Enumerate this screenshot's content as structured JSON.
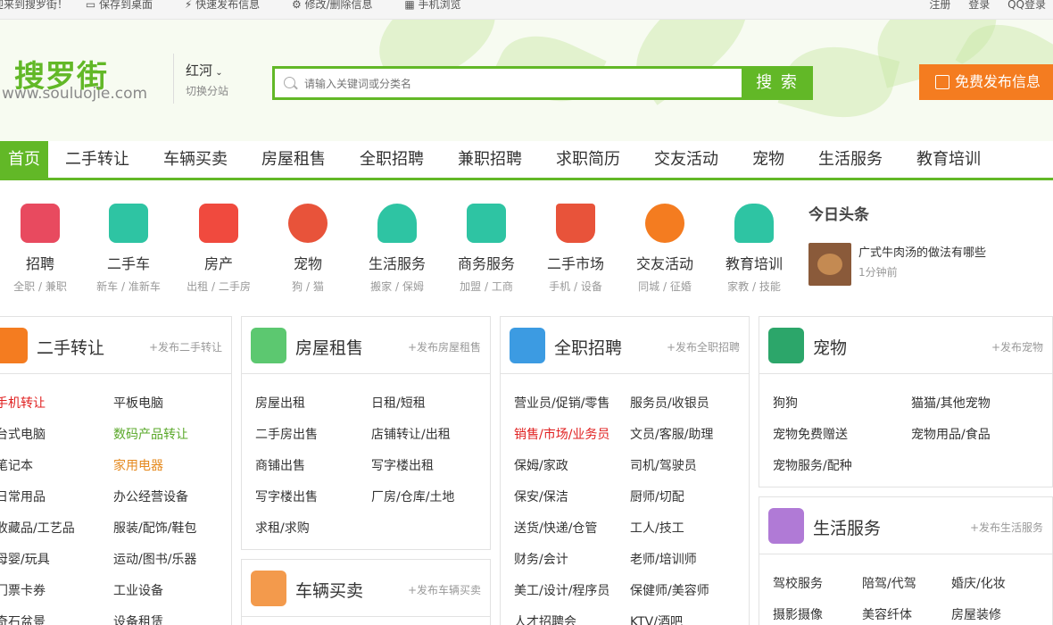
{
  "topbar": {
    "left": [
      "迎来到搜罗街！",
      "保存到桌面",
      "快速发布信息",
      "修改/删除信息",
      "手机浏览"
    ],
    "right": [
      "注册",
      "登录",
      "QQ登录"
    ]
  },
  "header": {
    "logo": "搜罗街",
    "logo_url": "www.souluojie.com",
    "city": "红河",
    "city_switch": "切换分站",
    "search_placeholder": "请输入关键词或分类名",
    "search_button": "搜 索",
    "publish_button": "免费发布信息"
  },
  "nav": [
    "首页",
    "二手转让",
    "车辆买卖",
    "房屋租售",
    "全职招聘",
    "兼职招聘",
    "求职简历",
    "交友活动",
    "宠物",
    "生活服务",
    "教育培训"
  ],
  "categories": [
    {
      "name": "招聘",
      "sub": "全职 / 兼职",
      "icon": "briefcase-icon",
      "color": "#e84a5f"
    },
    {
      "name": "二手车",
      "sub": "新车 / 准新车",
      "icon": "car-icon",
      "color": "#2ec4a3"
    },
    {
      "name": "房产",
      "sub": "出租 / 二手房",
      "icon": "building-icon",
      "color": "#f04a3e"
    },
    {
      "name": "宠物",
      "sub": "狗 / 猫",
      "icon": "dog-icon",
      "color": "#e8533a"
    },
    {
      "name": "生活服务",
      "sub": "搬家 / 保姆",
      "icon": "cleaner-icon",
      "color": "#2ec4a3"
    },
    {
      "name": "商务服务",
      "sub": "加盟 / 工商",
      "icon": "briefcase-icon",
      "color": "#2ec4a3"
    },
    {
      "name": "二手市场",
      "sub": "手机 / 设备",
      "icon": "cart-icon",
      "color": "#e8533a"
    },
    {
      "name": "交友活动",
      "sub": "同城 / 征婚",
      "icon": "handshake-icon",
      "color": "#f47c20"
    },
    {
      "name": "教育培训",
      "sub": "家教 / 技能",
      "icon": "graduation-cap-icon",
      "color": "#2ec4a3"
    }
  ],
  "news": {
    "title": "今日头条",
    "headline": "广式牛肉汤的做法有哪些",
    "time": "1分钟前"
  },
  "boxes": {
    "used": {
      "title": "二手转让",
      "post": "+发布二手转让",
      "color": "#f47c20",
      "left": [
        "手机转让",
        "台式电脑",
        "笔记本",
        "日常用品",
        "收藏品/工艺品",
        "母婴/玩具",
        "门票卡券",
        "奇石盆景"
      ],
      "right": [
        "平板电脑",
        "数码产品转让",
        "家用电器",
        "办公经营设备",
        "服装/配饰/鞋包",
        "运动/图书/乐器",
        "工业设备",
        "设备租赁"
      ]
    },
    "house": {
      "title": "房屋租售",
      "post": "+发布房屋租售",
      "color": "#5cc870",
      "left": [
        "房屋出租",
        "二手房出售",
        "商铺出售",
        "写字楼出售",
        "求租/求购"
      ],
      "right": [
        "日租/短租",
        "店铺转让/出租",
        "写字楼出租",
        "厂房/仓库/土地"
      ]
    },
    "car": {
      "title": "车辆买卖",
      "post": "+发布车辆买卖",
      "color": "#f39a4c"
    },
    "job": {
      "title": "全职招聘",
      "post": "+发布全职招聘",
      "color": "#3c9be2",
      "left": [
        "营业员/促销/零售",
        "销售/市场/业务员",
        "保姆/家政",
        "保安/保洁",
        "送货/快递/仓管",
        "财务/会计",
        "美工/设计/程序员",
        "人才招聘会"
      ],
      "right": [
        "服务员/收银员",
        "文员/客服/助理",
        "司机/驾驶员",
        "厨师/切配",
        "工人/技工",
        "老师/培训师",
        "保健师/美容师",
        "KTV/酒吧"
      ]
    },
    "pet": {
      "title": "宠物",
      "post": "+发布宠物",
      "color": "#2ca66a",
      "left": [
        "狗狗",
        "宠物免费赠送",
        "宠物服务/配种"
      ],
      "right": [
        "猫猫/其他宠物",
        "宠物用品/食品"
      ]
    },
    "life": {
      "title": "生活服务",
      "post": "+发布生活服务",
      "color": "#b07ad6",
      "c1": [
        "驾校服务",
        "摄影摄像"
      ],
      "c2": [
        "陪驾/代驾",
        "美容纤体"
      ],
      "c3": [
        "婚庆/化妆",
        "房屋装修"
      ]
    }
  }
}
